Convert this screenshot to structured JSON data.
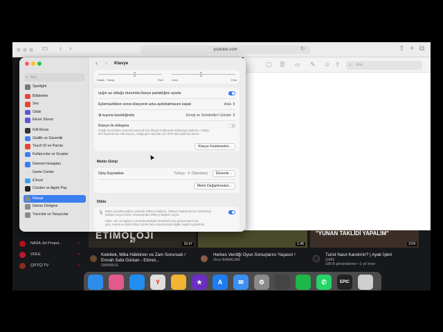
{
  "safari": {
    "url": "youtube.com"
  },
  "yt": {
    "search_placeholder": "Ara",
    "channels": [
      {
        "name": "NASA Jet Propul...",
        "badge": "••",
        "color": "#b4121d"
      },
      {
        "name": "VOLE",
        "badge": "••",
        "color": "#c0182c"
      },
      {
        "name": "ÇİFTÇİ TV",
        "badge": "••",
        "color": "#8b2a1e"
      }
    ],
    "videos": [
      {
        "thumb_text": "ETİMOLOJİ",
        "thumb_sub": "#7",
        "duration": "16:47",
        "title": "Kelebek, Mika Häkkinen ve Zam Sorunsalı / Emrah Safa Gürkan - Etimol...",
        "channel": "OMNIBUS",
        "views": "",
        "thumb_color": "#2d2a22"
      },
      {
        "thumb_text": "",
        "thumb_sub": "",
        "duration": "1:46",
        "title": "Herkes Verdiği Oyun Sonuçlarını Yaşasın !",
        "channel": "Onur BABACAN",
        "views": "",
        "thumb_color": "#4a4a2c"
      },
      {
        "thumb_text": "\"YUNAN TAKLİDİ YAPALIM\"",
        "thumb_sub": "",
        "duration": "3:04",
        "title": "Turist Nasıl Kandırılır? | Ayak İşleri",
        "channel": "GAİN",
        "views": "185 B görüntüleme • 1 yıl önce",
        "thumb_color": "#3c2f28"
      }
    ]
  },
  "dock": [
    {
      "name": "finder-icon",
      "label": "",
      "color": "#2e8de8"
    },
    {
      "name": "launchpad-icon",
      "label": "",
      "color": "#e25a8c"
    },
    {
      "name": "safari-icon",
      "label": "",
      "color": "#1f8ef0"
    },
    {
      "name": "yandex-icon",
      "label": "Y",
      "color": "#e0e0e0"
    },
    {
      "name": "photos-icon",
      "label": "",
      "color": "#f2b431"
    },
    {
      "name": "imovie-icon",
      "label": "★",
      "color": "#6a2fbf"
    },
    {
      "name": "app-store-icon",
      "label": "A",
      "color": "#1f7cf0"
    },
    {
      "name": "mail-icon",
      "label": "✉",
      "color": "#3d8ef2"
    },
    {
      "name": "system-settings-icon",
      "label": "⚙",
      "color": "#8a8a8a"
    },
    {
      "name": "iphone-mirroring-icon",
      "label": "",
      "color": "#444"
    },
    {
      "name": "numbers-icon",
      "label": "",
      "color": "#1db84a"
    },
    {
      "name": "whatsapp-icon",
      "label": "✆",
      "color": "#25d366"
    },
    {
      "name": "epic-games-icon",
      "label": "EPIC",
      "color": "#222"
    },
    {
      "name": "trash-icon",
      "label": "",
      "color": "#cfcfcf"
    }
  ],
  "settings": {
    "title": "Klavye",
    "search_placeholder": "Ara",
    "sidebar": [
      {
        "label": "Spotlight",
        "color": "#7a7a7a"
      },
      {
        "label": "Bildirimler",
        "color": "#e8443a"
      },
      {
        "label": "Ses",
        "color": "#e8443a"
      },
      {
        "label": "Odak",
        "color": "#5e57d6"
      },
      {
        "label": "Ekran Süresi",
        "color": "#5e57d6"
      },
      {
        "label": "Kilit Ekran",
        "color": "#333"
      },
      {
        "label": "Gizlilik ve Güvenlik",
        "color": "#3b7ef2"
      },
      {
        "label": "Touch ID ve Parola",
        "color": "#e8443a"
      },
      {
        "label": "Kullanıcılar ve Gruplar",
        "color": "#3b7ef2"
      },
      {
        "label": "İnternet Hesapları",
        "color": "#3b7ef2"
      },
      {
        "label": "Game Center",
        "color": "#e0e0e0"
      },
      {
        "label": "iCloud",
        "color": "#3b9df2"
      },
      {
        "label": "Cüzdan ve Apple Pay",
        "color": "#222"
      },
      {
        "label": "Klavye",
        "color": "#8a8a8a"
      },
      {
        "label": "İzleme Dörtgeni",
        "color": "#8a8a8a"
      },
      {
        "label": "Yazıcılar ve Tarayıcılar",
        "color": "#8a8a8a"
      }
    ],
    "selected_index": 13,
    "slider1": {
      "left": "Kapalı",
      "left2": "Yavaş",
      "right": "Hızlı",
      "value": 0.55
    },
    "slider2": {
      "left": "Uzun",
      "right": "Kısa",
      "value": 0.45
    },
    "rows": {
      "brightness": "Işığın az olduğu durumda klavye parlaklığını ayarla",
      "backlight_off": "Eylemsizlikten sonra klavyenin arka aydınlatmasını kapat",
      "backlight_value": "Asla",
      "globe_key": "tuşuna basıldığında",
      "globe_value": "Emoji ve Semboller'i Göster",
      "navigation": "Klavye ile dolaşma",
      "navigation_desc1": "Odağı denetimler arasında taşımak için klavye kullanarak dolaşmayı kullanın. Odağı",
      "navigation_desc2": "ileri taşımak için Tab tuşunu, odağı geri taşımak için Shift Tab tuşlarına basın.",
      "shortcuts_button": "Klavye Kestirmeleri...",
      "text_input_header": "Metin Girişi",
      "input_sources": "Giriş Kaynakları",
      "input_sources_value": "Türkçe - F (Standart)",
      "edit_button": "Düzenle...",
      "text_replacements_button": "Metin Değiştirmeleri...",
      "dictation_header": "Dikte",
      "dictation_desc1": "Metin yazabileceğiniz yerlerde Dikte'yi kullanın. Dikteye başlamak için kestirmeyi",
      "dictation_desc2": "kullanın veya Düzen menüsünden Dikte'yi Başlat'ı seçin.",
      "dictation_desc3": "Dikte, Siri ve İngilizce (Amerika Birleşik Devletleri) ses girişini Mac'inize",
      "dictation_desc4": "gön. Arama ve dahi birkaç cümle bunu durumunda bilgiler Apple'a gönderilir."
    }
  }
}
